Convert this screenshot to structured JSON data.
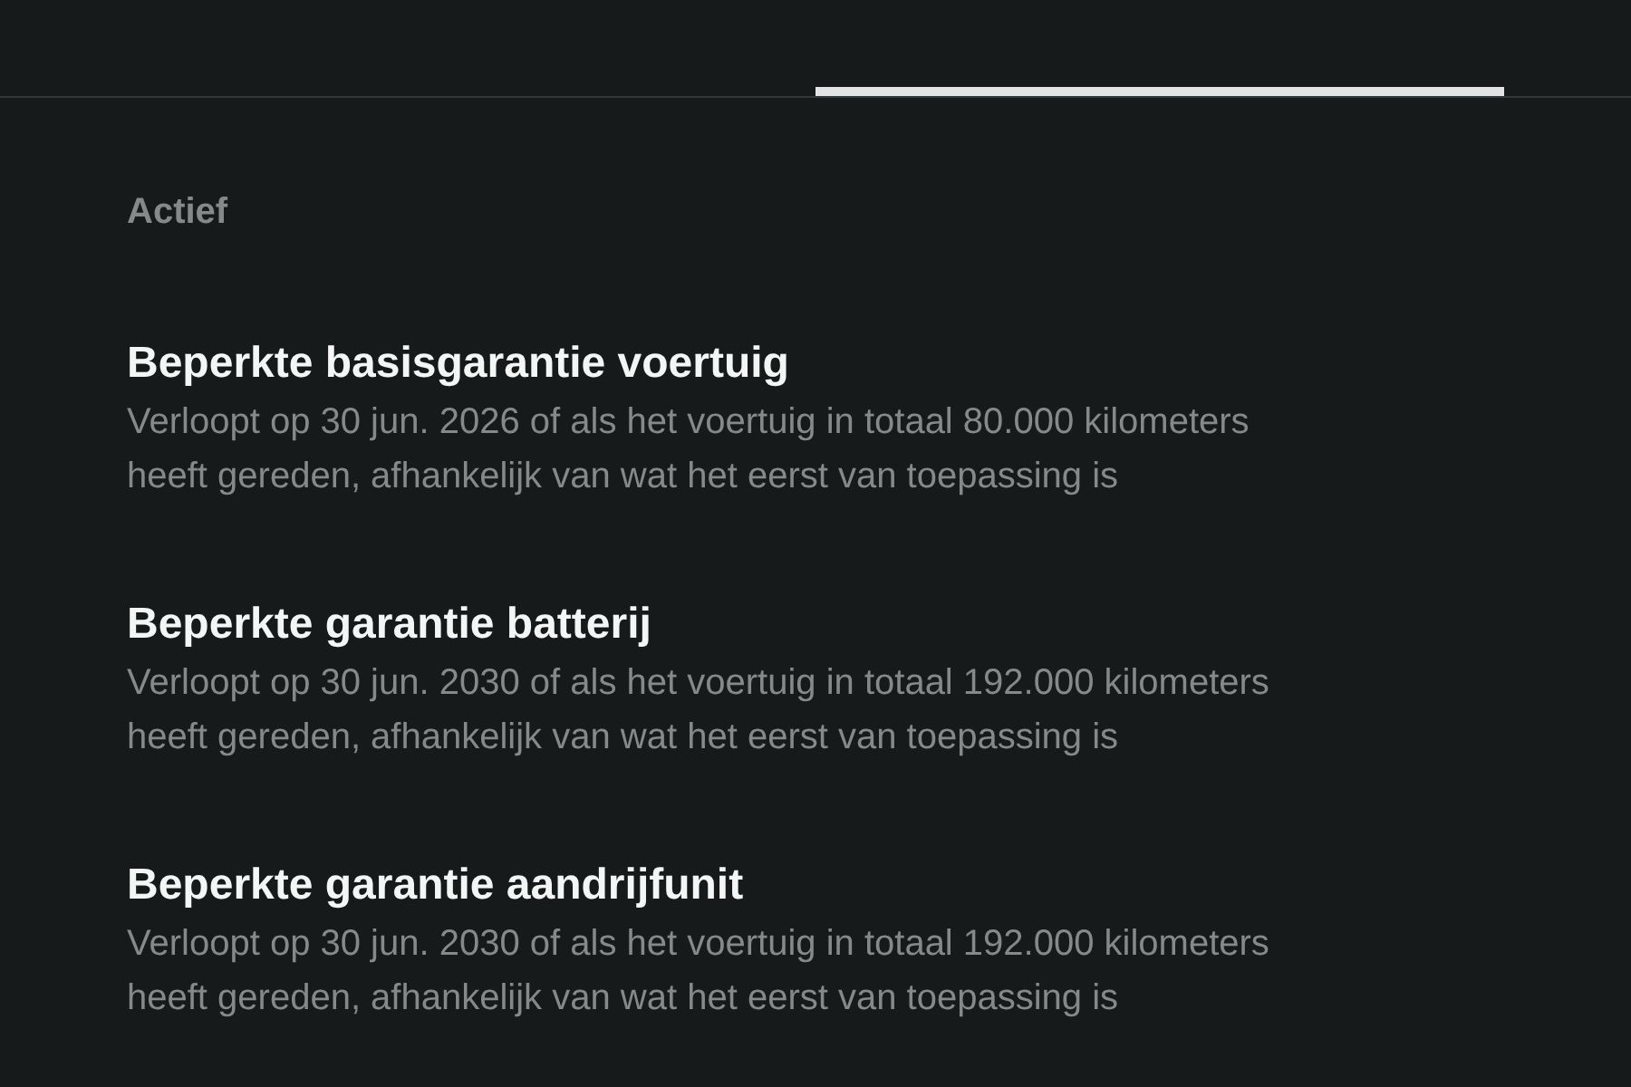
{
  "tabs": [
    {
      "selected": true
    }
  ],
  "section": {
    "title": "Actief"
  },
  "warranties": [
    {
      "title": "Beperkte basisgarantie voertuig",
      "description": "Verloopt op 30 jun. 2026 of als het voertuig in totaal 80.000 kilometers heeft gereden, afhankelijk van wat het eerst van toepassing is"
    },
    {
      "title": "Beperkte garantie batterij",
      "description": "Verloopt op 30 jun. 2030 of als het voertuig in totaal 192.000 kilometers heeft gereden, afhankelijk van wat het eerst van toepassing is"
    },
    {
      "title": "Beperkte garantie aandrijfunit",
      "description": "Verloopt op 30 jun. 2030 of als het voertuig in totaal 192.000 kilometers heeft gereden, afhankelijk van wat het eerst van toepassing is"
    }
  ]
}
